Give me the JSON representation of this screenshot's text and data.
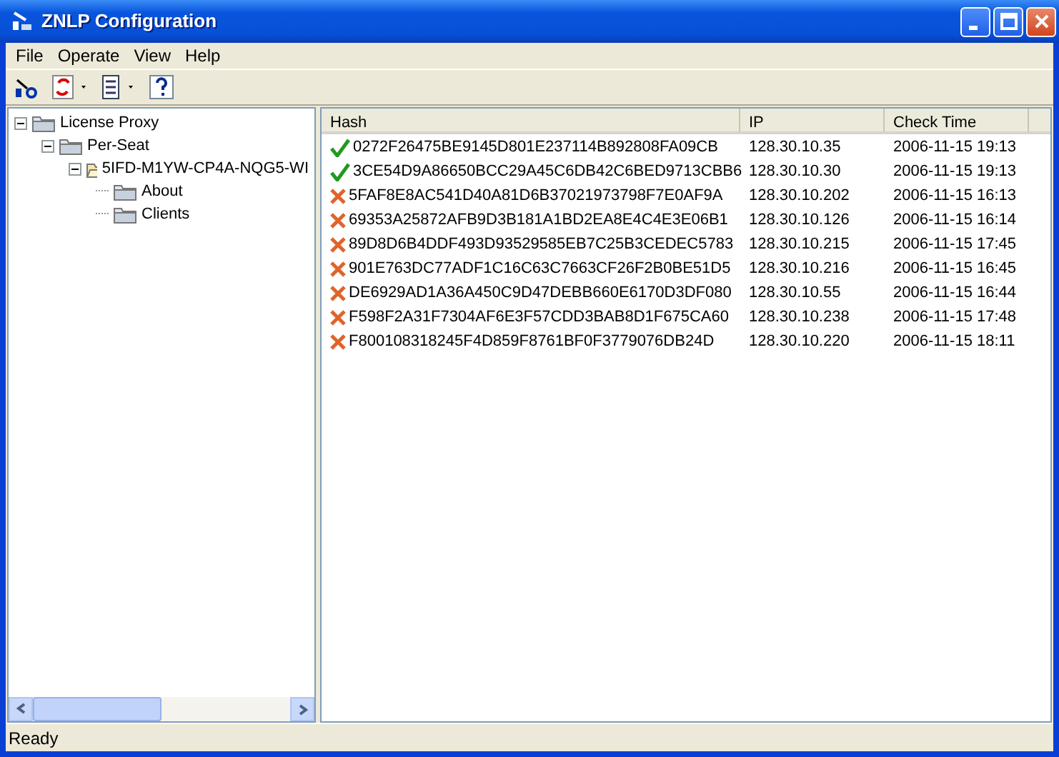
{
  "window": {
    "title": "ZNLP Configuration"
  },
  "menu": [
    "File",
    "Operate",
    "View",
    "Help"
  ],
  "tree": [
    {
      "label": "License Proxy",
      "expanded": true,
      "children": [
        {
          "label": "Per-Seat",
          "expanded": true,
          "children": [
            {
              "label": "5IFD-M1YW-CP4A-NQG5-WI",
              "expanded": true,
              "kind": "open-folder",
              "children": [
                {
                  "label": "About"
                },
                {
                  "label": "Clients"
                }
              ]
            }
          ]
        }
      ]
    }
  ],
  "table": {
    "columns": [
      "Hash",
      "IP",
      "Check Time"
    ],
    "rows": [
      {
        "kind": "ok",
        "cells": [
          "0272F26475BE9145D801E237114B892808FA09CB",
          "128.30.10.35",
          "2006-11-15 19:13"
        ]
      },
      {
        "kind": "ok",
        "cells": [
          "3CE54D9A86650BCC29A45C6DB42C6BED9713CBB6",
          "128.30.10.30",
          "2006-11-15 19:13"
        ]
      },
      {
        "kind": "fail",
        "cells": [
          "5FAF8E8AC541D40A81D6B37021973798F7E0AF9A",
          "128.30.10.202",
          "2006-11-15 16:13"
        ]
      },
      {
        "kind": "fail",
        "cells": [
          "69353A25872AFB9D3B181A1BD2EA8E4C4E3E06B1",
          "128.30.10.126",
          "2006-11-15 16:14"
        ]
      },
      {
        "kind": "fail",
        "cells": [
          "89D8D6B4DDF493D93529585EB7C25B3CEDEC5783",
          "128.30.10.215",
          "2006-11-15 17:45"
        ]
      },
      {
        "kind": "fail",
        "cells": [
          "901E763DC77ADF1C16C63C7663CF26F2B0BE51D5",
          "128.30.10.216",
          "2006-11-15 16:45"
        ]
      },
      {
        "kind": "fail",
        "cells": [
          "DE6929AD1A36A450C9D47DEBB660E6170D3DF080",
          "128.30.10.55",
          "2006-11-15 16:44"
        ]
      },
      {
        "kind": "fail",
        "cells": [
          "F598F2A31F7304AF6E3F57CDD3BAB8D1F675CA60",
          "128.30.10.238",
          "2006-11-15 17:48"
        ]
      },
      {
        "kind": "fail",
        "cells": [
          "F800108318245F4D859F8761BF0F3779076DB24D",
          "128.30.10.220",
          "2006-11-15 18:11"
        ]
      }
    ]
  },
  "status_bar": "Ready"
}
